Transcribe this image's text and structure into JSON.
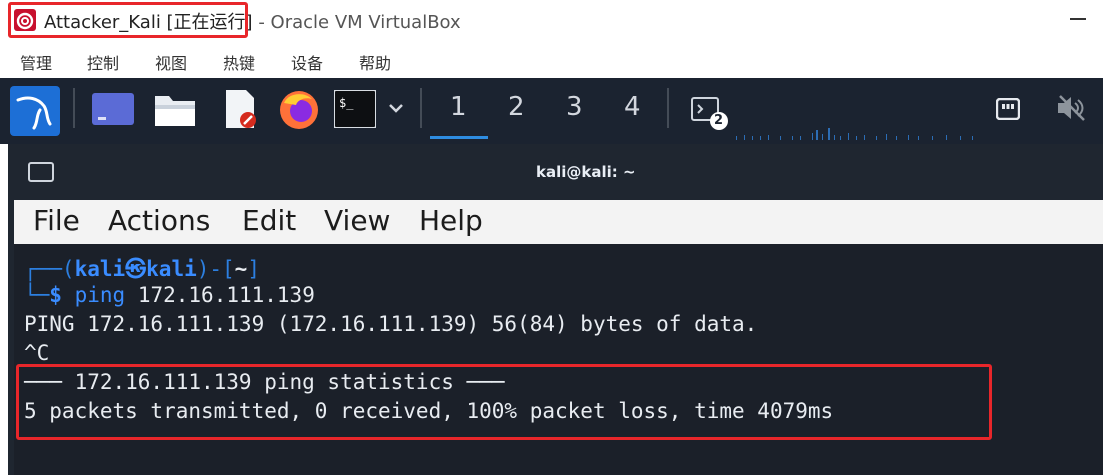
{
  "window": {
    "vm_name": "Attacker_Kali [正在运行]",
    "app_suffix": " - Oracle VM VirtualBox"
  },
  "menubar": [
    "管理",
    "控制",
    "视图",
    "热键",
    "设备",
    "帮助"
  ],
  "panel": {
    "workspaces": [
      "1",
      "2",
      "3",
      "4"
    ],
    "active_workspace": "1",
    "terminal_badge": "2",
    "terminal_icon_text": "$_"
  },
  "terminal": {
    "title": "kali@kali: ~",
    "menu": [
      "File",
      "Actions",
      "Edit",
      "View",
      "Help"
    ],
    "prompt": {
      "open": "┌──(",
      "user": "kali",
      "at": "㉿",
      "host": "kali",
      "mid": ")-[",
      "path": "~",
      "close": "]",
      "lead": "└─",
      "dollar": "$"
    },
    "command": {
      "name": "ping",
      "args": " 172.16.111.139"
    },
    "output": [
      "PING 172.16.111.139 (172.16.111.139) 56(84) bytes of data.",
      "^C",
      "─── 172.16.111.139 ping statistics ───",
      "5 packets transmitted, 0 received, 100% packet loss, time 4079ms"
    ]
  },
  "colors": {
    "highlight": "#e8262a",
    "panel_bg": "#1b2330",
    "terminal_bg": "#1b2029",
    "prompt_blue": "#3a8cff"
  }
}
